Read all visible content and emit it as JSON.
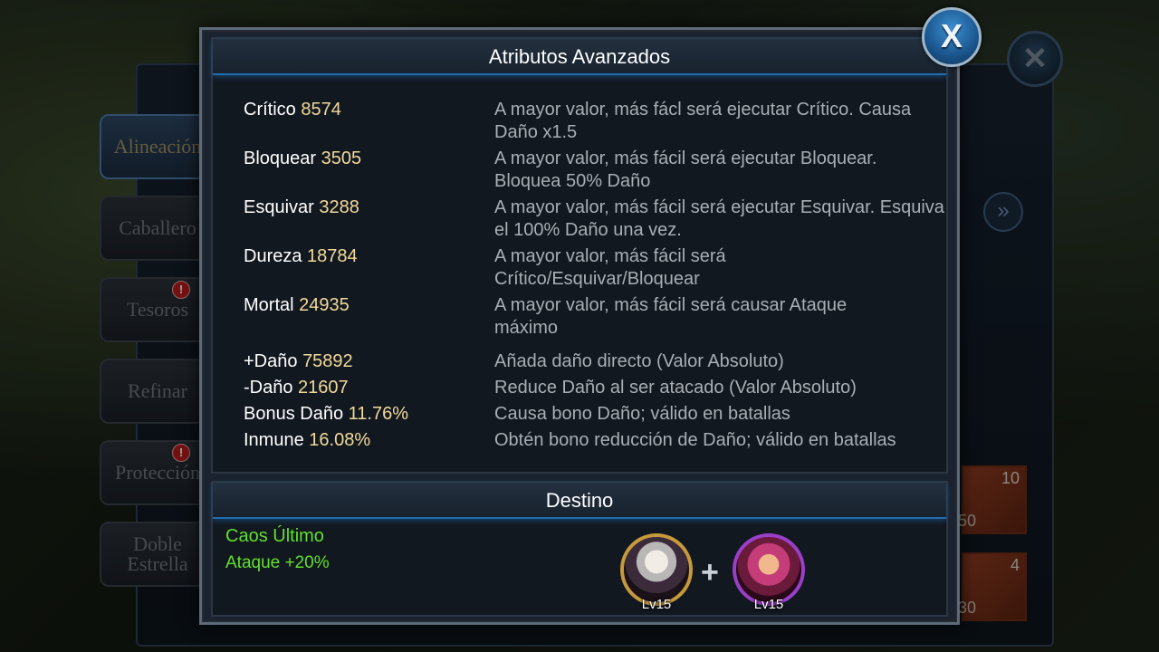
{
  "background": {
    "tabs": [
      {
        "label": "Alineación",
        "active": true
      },
      {
        "label": "Caballero",
        "active": false
      },
      {
        "label": "Tesoros",
        "active": false,
        "badge": "!"
      },
      {
        "label": "Refinar",
        "active": false
      },
      {
        "label": "Protección",
        "active": false,
        "badge": "!"
      },
      {
        "label": "Doble Estrella",
        "active": false
      }
    ],
    "close_icon": "close-icon",
    "arrow_icon": "double-chevron-right-icon",
    "items": [
      {
        "count": "10",
        "number": "50"
      },
      {
        "count": "4",
        "number": "30"
      }
    ]
  },
  "modal": {
    "title": "Atributos Avanzados",
    "close_label": "X",
    "attributes": [
      {
        "name": "Crítico",
        "value": "8574",
        "desc": "A mayor valor, más fácl será ejecutar Crítico. Causa Daño x1.5"
      },
      {
        "name": "Bloquear",
        "value": "3505",
        "desc": "A mayor valor, más fácil será ejecutar Bloquear. Bloquea 50% Daño"
      },
      {
        "name": "Esquivar",
        "value": "3288",
        "desc": "A mayor valor, más fácil será ejecutar Esquivar. Esquiva el 100% Daño una vez."
      },
      {
        "name": "Dureza",
        "value": "18784",
        "desc": "A mayor valor, más fácil será Crítico/Esquivar/Bloquear"
      },
      {
        "name": "Mortal",
        "value": "24935",
        "desc": "A mayor valor, más fácil será causar Ataque máximo"
      },
      {
        "name": "+Daño",
        "value": "75892",
        "desc": "Añada daño directo (Valor Absoluto)"
      },
      {
        "name": "-Daño",
        "value": "21607",
        "desc": "Reduce Daño al ser atacado (Valor Absoluto)"
      },
      {
        "name": "Bonus Daño",
        "value": "11.76%",
        "desc": "Causa bono Daño; válido en batallas"
      },
      {
        "name": "Inmune",
        "value": "16.08%",
        "desc": "Obtén bono reducción de Daño; válido en batallas"
      }
    ],
    "destiny": {
      "title": "Destino",
      "name": "Caos Último",
      "bonus": "Ataque +20%",
      "heroes": [
        {
          "level": "Lv15"
        },
        {
          "level": "Lv15"
        }
      ],
      "plus": "+"
    }
  },
  "colors": {
    "value_gold": "#f2d99a",
    "desc_gray": "#a9aeb4",
    "destiny_green": "#5fe02b",
    "title_glow": "#1f6db0"
  }
}
